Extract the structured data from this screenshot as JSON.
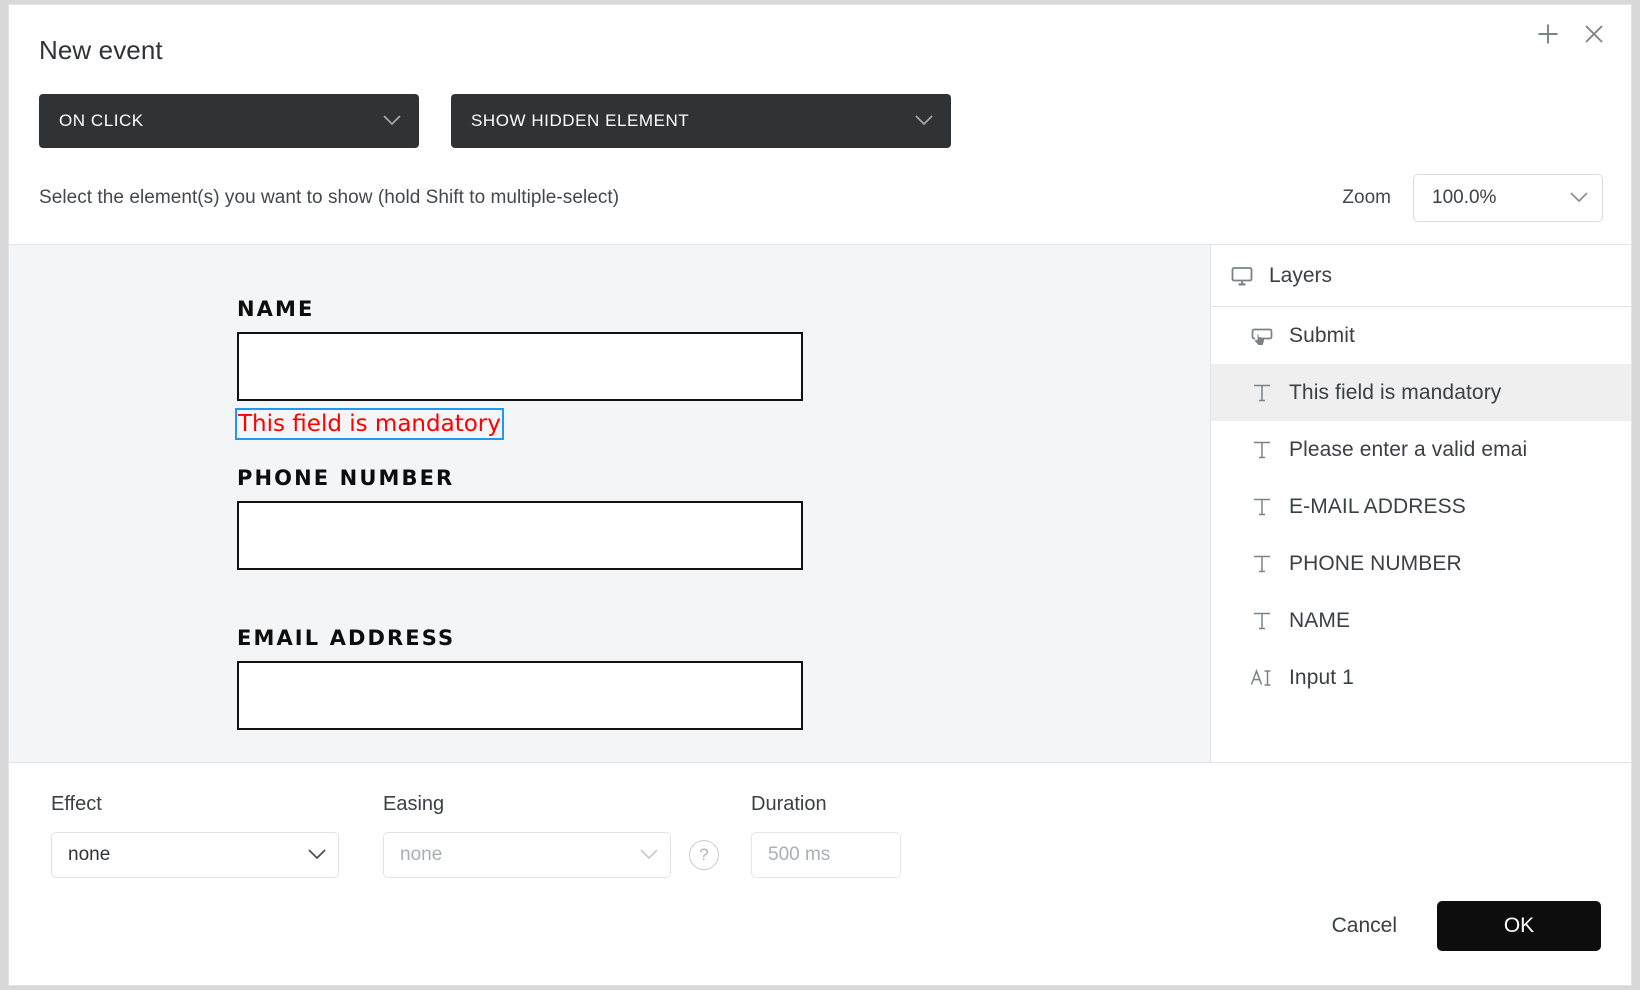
{
  "dialog": {
    "title": "New event",
    "add_icon": "plus-icon",
    "close_icon": "close-icon"
  },
  "event_selects": {
    "trigger": {
      "value": "ON CLICK",
      "caret": "chevron-down-icon"
    },
    "action": {
      "value": "SHOW HIDDEN ELEMENT",
      "caret": "chevron-down-icon"
    }
  },
  "instruction": {
    "text": "Select the element(s) you want to show (hold Shift to multiple-select)",
    "zoom_label": "Zoom",
    "zoom_value": "100.0%"
  },
  "canvas": {
    "fields": [
      {
        "label": "NAME",
        "error": "This field is mandatory",
        "selected": true
      },
      {
        "label": "PHONE NUMBER",
        "error": null,
        "selected": false
      },
      {
        "label": "EMAIL ADDRESS",
        "error": null,
        "selected": false
      }
    ],
    "background": "#f4f5f7",
    "selection_color": "#2196f3",
    "error_color": "#ff0000"
  },
  "layers": {
    "header": "Layers",
    "header_icon": "monitor-icon",
    "items": [
      {
        "label": "Submit",
        "icon": "button-click-icon",
        "selected": false
      },
      {
        "label": "This field is mandatory",
        "icon": "text-icon",
        "selected": true
      },
      {
        "label": "Please enter a valid emai",
        "icon": "text-icon",
        "selected": false
      },
      {
        "label": "E-MAIL ADDRESS",
        "icon": "text-icon",
        "selected": false
      },
      {
        "label": "PHONE NUMBER",
        "icon": "text-icon",
        "selected": false
      },
      {
        "label": "NAME",
        "icon": "text-icon",
        "selected": false
      },
      {
        "label": "Input 1",
        "icon": "text-input-icon",
        "selected": false
      }
    ]
  },
  "footer": {
    "effect_label": "Effect",
    "effect_value": "none",
    "easing_label": "Easing",
    "easing_value": "none",
    "help_icon": "question-mark-icon",
    "duration_label": "Duration",
    "duration_placeholder": "500 ms",
    "duration_value": "",
    "cancel_label": "Cancel",
    "ok_label": "OK",
    "ok_color": "#0d0d0d"
  }
}
